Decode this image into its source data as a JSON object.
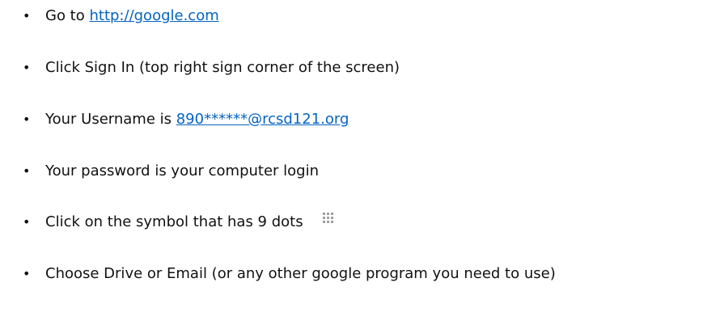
{
  "steps": [
    {
      "bullet": "•",
      "prefix": "Go to ",
      "link": "http://google.com"
    },
    {
      "bullet": "•",
      "text": "Click Sign In (top right sign corner of the screen)"
    },
    {
      "bullet": "•",
      "prefix": "Your Username is ",
      "link": "890******@rcsd121.org"
    },
    {
      "bullet": "•",
      "text": "Your password is your computer login"
    },
    {
      "bullet": "•",
      "text": "Click on the symbol that has 9 dots",
      "icon": "nine-dots-grid-icon"
    },
    {
      "bullet": "•",
      "text": "Choose Drive  or Email (or any other google program you need to use)"
    }
  ],
  "colors": {
    "text": "#111111",
    "link": "#0563c1",
    "icon": "#9e9e9e"
  }
}
